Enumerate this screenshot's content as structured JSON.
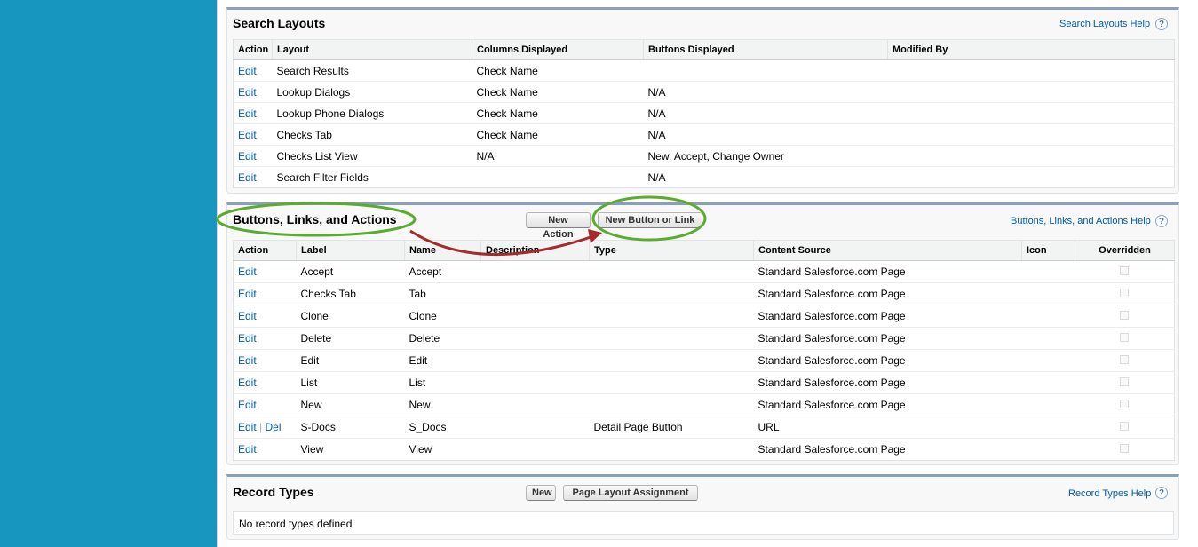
{
  "search_layouts": {
    "title": "Search Layouts",
    "help_label": "Search Layouts Help",
    "help_icon": "?",
    "columns": [
      "Action",
      "Layout",
      "Columns Displayed",
      "Buttons Displayed",
      "Modified By"
    ],
    "rows": [
      {
        "action": "Edit",
        "layout": "Search Results",
        "columns": "Check Name",
        "buttons": "",
        "modified_by": ""
      },
      {
        "action": "Edit",
        "layout": "Lookup Dialogs",
        "columns": "Check Name",
        "buttons": "N/A",
        "modified_by": ""
      },
      {
        "action": "Edit",
        "layout": "Lookup Phone Dialogs",
        "columns": "Check Name",
        "buttons": "N/A",
        "modified_by": ""
      },
      {
        "action": "Edit",
        "layout": "Checks Tab",
        "columns": "Check Name",
        "buttons": "N/A",
        "modified_by": ""
      },
      {
        "action": "Edit",
        "layout": "Checks List View",
        "columns": "N/A",
        "buttons": "New, Accept, Change Owner",
        "modified_by": ""
      },
      {
        "action": "Edit",
        "layout": "Search Filter Fields",
        "columns": "",
        "buttons": "N/A",
        "modified_by": ""
      }
    ]
  },
  "buttons_links": {
    "title": "Buttons, Links, and Actions",
    "new_action_label": "New Action",
    "new_button_label": "New Button or Link",
    "help_label": "Buttons, Links, and Actions Help",
    "help_icon": "?",
    "columns": [
      "Action",
      "Label",
      "Name",
      "Description",
      "Type",
      "Content Source",
      "Icon",
      "Overridden"
    ],
    "rows": [
      {
        "action": "Edit",
        "del": "",
        "label": "Accept",
        "name": "Accept",
        "description": "",
        "type": "",
        "source": "Standard Salesforce.com Page",
        "icon": "",
        "overridden": false
      },
      {
        "action": "Edit",
        "del": "",
        "label": "Checks Tab",
        "name": "Tab",
        "description": "",
        "type": "",
        "source": "Standard Salesforce.com Page",
        "icon": "",
        "overridden": false
      },
      {
        "action": "Edit",
        "del": "",
        "label": "Clone",
        "name": "Clone",
        "description": "",
        "type": "",
        "source": "Standard Salesforce.com Page",
        "icon": "",
        "overridden": false
      },
      {
        "action": "Edit",
        "del": "",
        "label": "Delete",
        "name": "Delete",
        "description": "",
        "type": "",
        "source": "Standard Salesforce.com Page",
        "icon": "",
        "overridden": false
      },
      {
        "action": "Edit",
        "del": "",
        "label": "Edit",
        "name": "Edit",
        "description": "",
        "type": "",
        "source": "Standard Salesforce.com Page",
        "icon": "",
        "overridden": false
      },
      {
        "action": "Edit",
        "del": "",
        "label": "List",
        "name": "List",
        "description": "",
        "type": "",
        "source": "Standard Salesforce.com Page",
        "icon": "",
        "overridden": false
      },
      {
        "action": "Edit",
        "del": "",
        "label": "New",
        "name": "New",
        "description": "",
        "type": "",
        "source": "Standard Salesforce.com Page",
        "icon": "",
        "overridden": false
      },
      {
        "action": "Edit",
        "separator": "|",
        "del": "Del",
        "label": "S-Docs",
        "name": "S_Docs",
        "description": "",
        "type": "Detail Page Button",
        "source": "URL",
        "icon": "",
        "overridden": false
      },
      {
        "action": "Edit",
        "del": "",
        "label": "View",
        "name": "View",
        "description": "",
        "type": "",
        "source": "Standard Salesforce.com Page",
        "icon": "",
        "overridden": false
      }
    ]
  },
  "record_types": {
    "title": "Record Types",
    "new_label": "New",
    "assignment_label": "Page Layout Assignment",
    "help_label": "Record Types Help",
    "help_icon": "?",
    "empty_text": "No record types defined"
  },
  "colors": {
    "sidebar": "#1797c0",
    "link": "#015ba7",
    "highlight_ellipse": "#5aac2e",
    "arrow": "#a52a2a",
    "section_border": "#8a9ebe"
  }
}
